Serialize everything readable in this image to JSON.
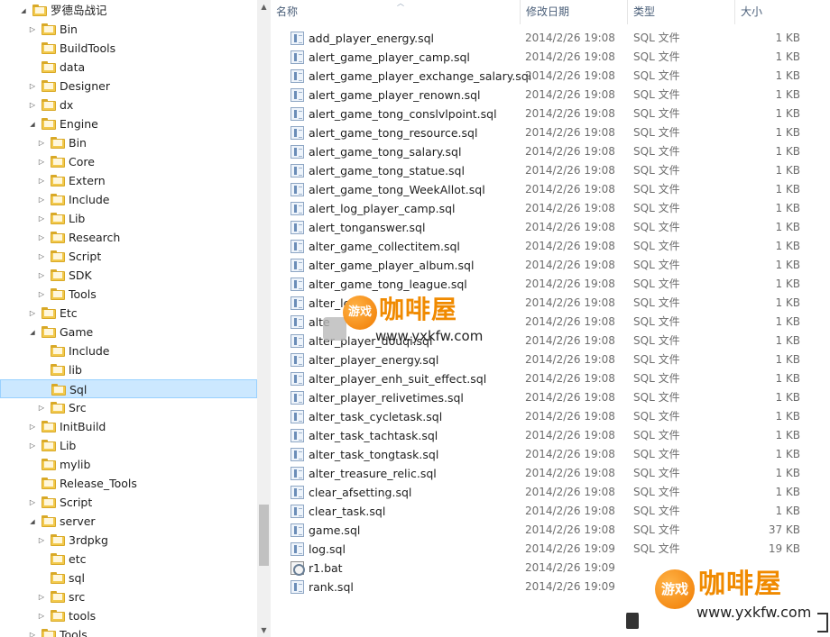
{
  "tree": {
    "nodes": [
      {
        "label": "罗德岛战记",
        "level": 0,
        "arrow": "expanded"
      },
      {
        "label": "Bin",
        "level": 1,
        "arrow": "collapsed"
      },
      {
        "label": "BuildTools",
        "level": 1,
        "arrow": "none"
      },
      {
        "label": "data",
        "level": 1,
        "arrow": "none"
      },
      {
        "label": "Designer",
        "level": 1,
        "arrow": "collapsed"
      },
      {
        "label": "dx",
        "level": 1,
        "arrow": "collapsed"
      },
      {
        "label": "Engine",
        "level": 1,
        "arrow": "expanded"
      },
      {
        "label": "Bin",
        "level": 2,
        "arrow": "collapsed"
      },
      {
        "label": "Core",
        "level": 2,
        "arrow": "collapsed"
      },
      {
        "label": "Extern",
        "level": 2,
        "arrow": "collapsed"
      },
      {
        "label": "Include",
        "level": 2,
        "arrow": "collapsed"
      },
      {
        "label": "Lib",
        "level": 2,
        "arrow": "collapsed"
      },
      {
        "label": "Research",
        "level": 2,
        "arrow": "collapsed"
      },
      {
        "label": "Script",
        "level": 2,
        "arrow": "collapsed"
      },
      {
        "label": "SDK",
        "level": 2,
        "arrow": "collapsed"
      },
      {
        "label": "Tools",
        "level": 2,
        "arrow": "collapsed"
      },
      {
        "label": "Etc",
        "level": 1,
        "arrow": "collapsed"
      },
      {
        "label": "Game",
        "level": 1,
        "arrow": "expanded"
      },
      {
        "label": "Include",
        "level": 2,
        "arrow": "none"
      },
      {
        "label": "lib",
        "level": 2,
        "arrow": "none"
      },
      {
        "label": "Sql",
        "level": 2,
        "arrow": "none",
        "selected": true
      },
      {
        "label": "Src",
        "level": 2,
        "arrow": "collapsed"
      },
      {
        "label": "InitBuild",
        "level": 1,
        "arrow": "collapsed"
      },
      {
        "label": "Lib",
        "level": 1,
        "arrow": "collapsed"
      },
      {
        "label": "mylib",
        "level": 1,
        "arrow": "none"
      },
      {
        "label": "Release_Tools",
        "level": 1,
        "arrow": "none"
      },
      {
        "label": "Script",
        "level": 1,
        "arrow": "collapsed"
      },
      {
        "label": "server",
        "level": 1,
        "arrow": "expanded"
      },
      {
        "label": "3rdpkg",
        "level": 2,
        "arrow": "collapsed"
      },
      {
        "label": "etc",
        "level": 2,
        "arrow": "none"
      },
      {
        "label": "sql",
        "level": 2,
        "arrow": "none"
      },
      {
        "label": "src",
        "level": 2,
        "arrow": "collapsed"
      },
      {
        "label": "tools",
        "level": 2,
        "arrow": "collapsed"
      },
      {
        "label": "Tools",
        "level": 1,
        "arrow": "collapsed"
      }
    ]
  },
  "columns": {
    "name": "名称",
    "date": "修改日期",
    "type": "类型",
    "size": "大小"
  },
  "files": [
    {
      "name": "add_player_energy.sql",
      "date": "2014/2/26 19:08",
      "type": "SQL 文件",
      "size": "1 KB",
      "icon": "sql"
    },
    {
      "name": "alert_game_player_camp.sql",
      "date": "2014/2/26 19:08",
      "type": "SQL 文件",
      "size": "1 KB",
      "icon": "sql"
    },
    {
      "name": "alert_game_player_exchange_salary.sql",
      "date": "2014/2/26 19:08",
      "type": "SQL 文件",
      "size": "1 KB",
      "icon": "sql"
    },
    {
      "name": "alert_game_player_renown.sql",
      "date": "2014/2/26 19:08",
      "type": "SQL 文件",
      "size": "1 KB",
      "icon": "sql"
    },
    {
      "name": "alert_game_tong_conslvlpoint.sql",
      "date": "2014/2/26 19:08",
      "type": "SQL 文件",
      "size": "1 KB",
      "icon": "sql"
    },
    {
      "name": "alert_game_tong_resource.sql",
      "date": "2014/2/26 19:08",
      "type": "SQL 文件",
      "size": "1 KB",
      "icon": "sql"
    },
    {
      "name": "alert_game_tong_salary.sql",
      "date": "2014/2/26 19:08",
      "type": "SQL 文件",
      "size": "1 KB",
      "icon": "sql"
    },
    {
      "name": "alert_game_tong_statue.sql",
      "date": "2014/2/26 19:08",
      "type": "SQL 文件",
      "size": "1 KB",
      "icon": "sql"
    },
    {
      "name": "alert_game_tong_WeekAllot.sql",
      "date": "2014/2/26 19:08",
      "type": "SQL 文件",
      "size": "1 KB",
      "icon": "sql"
    },
    {
      "name": "alert_log_player_camp.sql",
      "date": "2014/2/26 19:08",
      "type": "SQL 文件",
      "size": "1 KB",
      "icon": "sql"
    },
    {
      "name": "alert_tonganswer.sql",
      "date": "2014/2/26 19:08",
      "type": "SQL 文件",
      "size": "1 KB",
      "icon": "sql"
    },
    {
      "name": "alter_game_collectitem.sql",
      "date": "2014/2/26 19:08",
      "type": "SQL 文件",
      "size": "1 KB",
      "icon": "sql"
    },
    {
      "name": "alter_game_player_album.sql",
      "date": "2014/2/26 19:08",
      "type": "SQL 文件",
      "size": "1 KB",
      "icon": "sql"
    },
    {
      "name": "alter_game_tong_league.sql",
      "date": "2014/2/26 19:08",
      "type": "SQL 文件",
      "size": "1 KB",
      "icon": "sql"
    },
    {
      "name": "alter_lo",
      "date": "2014/2/26 19:08",
      "type": "SQL 文件",
      "size": "1 KB",
      "icon": "sql"
    },
    {
      "name": "alte",
      "date": "2014/2/26 19:08",
      "type": "SQL 文件",
      "size": "1 KB",
      "icon": "sql"
    },
    {
      "name": "alter_player_douqi.sql",
      "date": "2014/2/26 19:08",
      "type": "SQL 文件",
      "size": "1 KB",
      "icon": "sql"
    },
    {
      "name": "alter_player_energy.sql",
      "date": "2014/2/26 19:08",
      "type": "SQL 文件",
      "size": "1 KB",
      "icon": "sql"
    },
    {
      "name": "alter_player_enh_suit_effect.sql",
      "date": "2014/2/26 19:08",
      "type": "SQL 文件",
      "size": "1 KB",
      "icon": "sql"
    },
    {
      "name": "alter_player_relivetimes.sql",
      "date": "2014/2/26 19:08",
      "type": "SQL 文件",
      "size": "1 KB",
      "icon": "sql"
    },
    {
      "name": "alter_task_cycletask.sql",
      "date": "2014/2/26 19:08",
      "type": "SQL 文件",
      "size": "1 KB",
      "icon": "sql"
    },
    {
      "name": "alter_task_tachtask.sql",
      "date": "2014/2/26 19:08",
      "type": "SQL 文件",
      "size": "1 KB",
      "icon": "sql"
    },
    {
      "name": "alter_task_tongtask.sql",
      "date": "2014/2/26 19:08",
      "type": "SQL 文件",
      "size": "1 KB",
      "icon": "sql"
    },
    {
      "name": "alter_treasure_relic.sql",
      "date": "2014/2/26 19:08",
      "type": "SQL 文件",
      "size": "1 KB",
      "icon": "sql"
    },
    {
      "name": "clear_afsetting.sql",
      "date": "2014/2/26 19:08",
      "type": "SQL 文件",
      "size": "1 KB",
      "icon": "sql"
    },
    {
      "name": "clear_task.sql",
      "date": "2014/2/26 19:08",
      "type": "SQL 文件",
      "size": "1 KB",
      "icon": "sql"
    },
    {
      "name": "game.sql",
      "date": "2014/2/26 19:08",
      "type": "SQL 文件",
      "size": "37 KB",
      "icon": "sql"
    },
    {
      "name": "log.sql",
      "date": "2014/2/26 19:09",
      "type": "SQL 文件",
      "size": "19 KB",
      "icon": "sql"
    },
    {
      "name": "r1.bat",
      "date": "2014/2/26 19:09",
      "type": "",
      "size": "",
      "icon": "bat"
    },
    {
      "name": "rank.sql",
      "date": "2014/2/26 19:09",
      "type": "",
      "size": "",
      "icon": "sql"
    }
  ],
  "watermark": {
    "badge": "游戏",
    "brand": "咖啡屋",
    "url": "www.yxkfw.com"
  }
}
